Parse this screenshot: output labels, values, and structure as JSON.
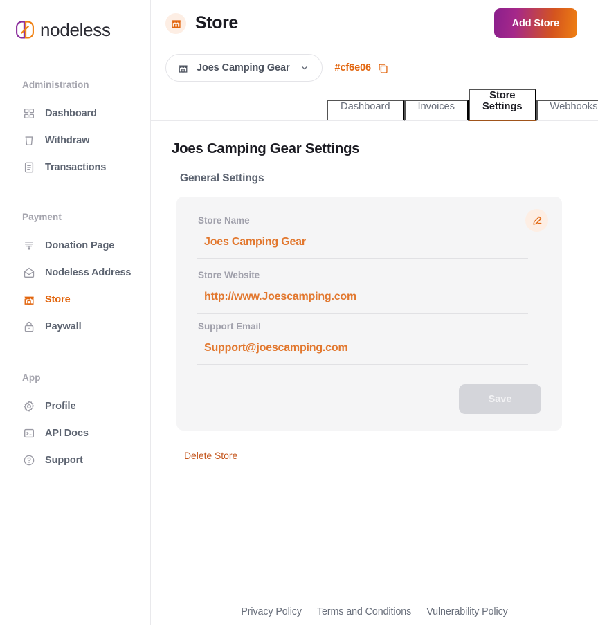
{
  "brand": {
    "name": "nodeless",
    "logo_icon": "nodeless-logo-icon",
    "purple": "#8a1f8c",
    "orange": "#e2660f"
  },
  "sidebar": {
    "sections": [
      {
        "title": "Administration",
        "items": [
          {
            "label": "Dashboard",
            "icon": "grid-icon",
            "active": false
          },
          {
            "label": "Withdraw",
            "icon": "withdraw-icon",
            "active": false
          },
          {
            "label": "Transactions",
            "icon": "document-icon",
            "active": false
          }
        ]
      },
      {
        "title": "Payment",
        "items": [
          {
            "label": "Donation Page",
            "icon": "donation-icon",
            "active": false
          },
          {
            "label": "Nodeless Address",
            "icon": "envelope-icon",
            "active": false
          },
          {
            "label": "Store",
            "icon": "store-icon",
            "active": true
          },
          {
            "label": "Paywall",
            "icon": "lock-icon",
            "active": false
          }
        ]
      },
      {
        "title": "App",
        "items": [
          {
            "label": "Profile",
            "icon": "gear-icon",
            "active": false
          },
          {
            "label": "API Docs",
            "icon": "terminal-icon",
            "active": false
          },
          {
            "label": "Support",
            "icon": "help-icon",
            "active": false
          }
        ]
      }
    ]
  },
  "header": {
    "icon": "store-icon",
    "title": "Store",
    "add_store_label": "Add Store",
    "accent_gradient_from": "#8a1f8c",
    "accent_gradient_to": "#ef8012"
  },
  "store_selector": {
    "icon": "store-icon",
    "selected": "Joes Camping Gear",
    "caret_icon": "chevron-down-icon",
    "store_id": "#cf6e06",
    "copy_icon": "copy-icon"
  },
  "tabs": [
    {
      "label": "Dashboard",
      "active": false
    },
    {
      "label": "Invoices",
      "active": false
    },
    {
      "label": "Store Settings",
      "active": true
    },
    {
      "label": "Webhooks",
      "active": false
    }
  ],
  "main": {
    "page_heading": "Joes Camping Gear Settings",
    "section_heading": "General Settings",
    "edit_icon": "pencil-icon",
    "fields": [
      {
        "label": "Store Name",
        "value": "Joes Camping Gear"
      },
      {
        "label": "Store Website",
        "value": "http://www.Joescamping.com"
      },
      {
        "label": "Support Email",
        "value": "Support@joescamping.com"
      }
    ],
    "save_label": "Save",
    "delete_label": "Delete Store"
  },
  "footer": {
    "links": [
      "Privacy Policy",
      "Terms and Conditions",
      "Vulnerability Policy"
    ]
  }
}
